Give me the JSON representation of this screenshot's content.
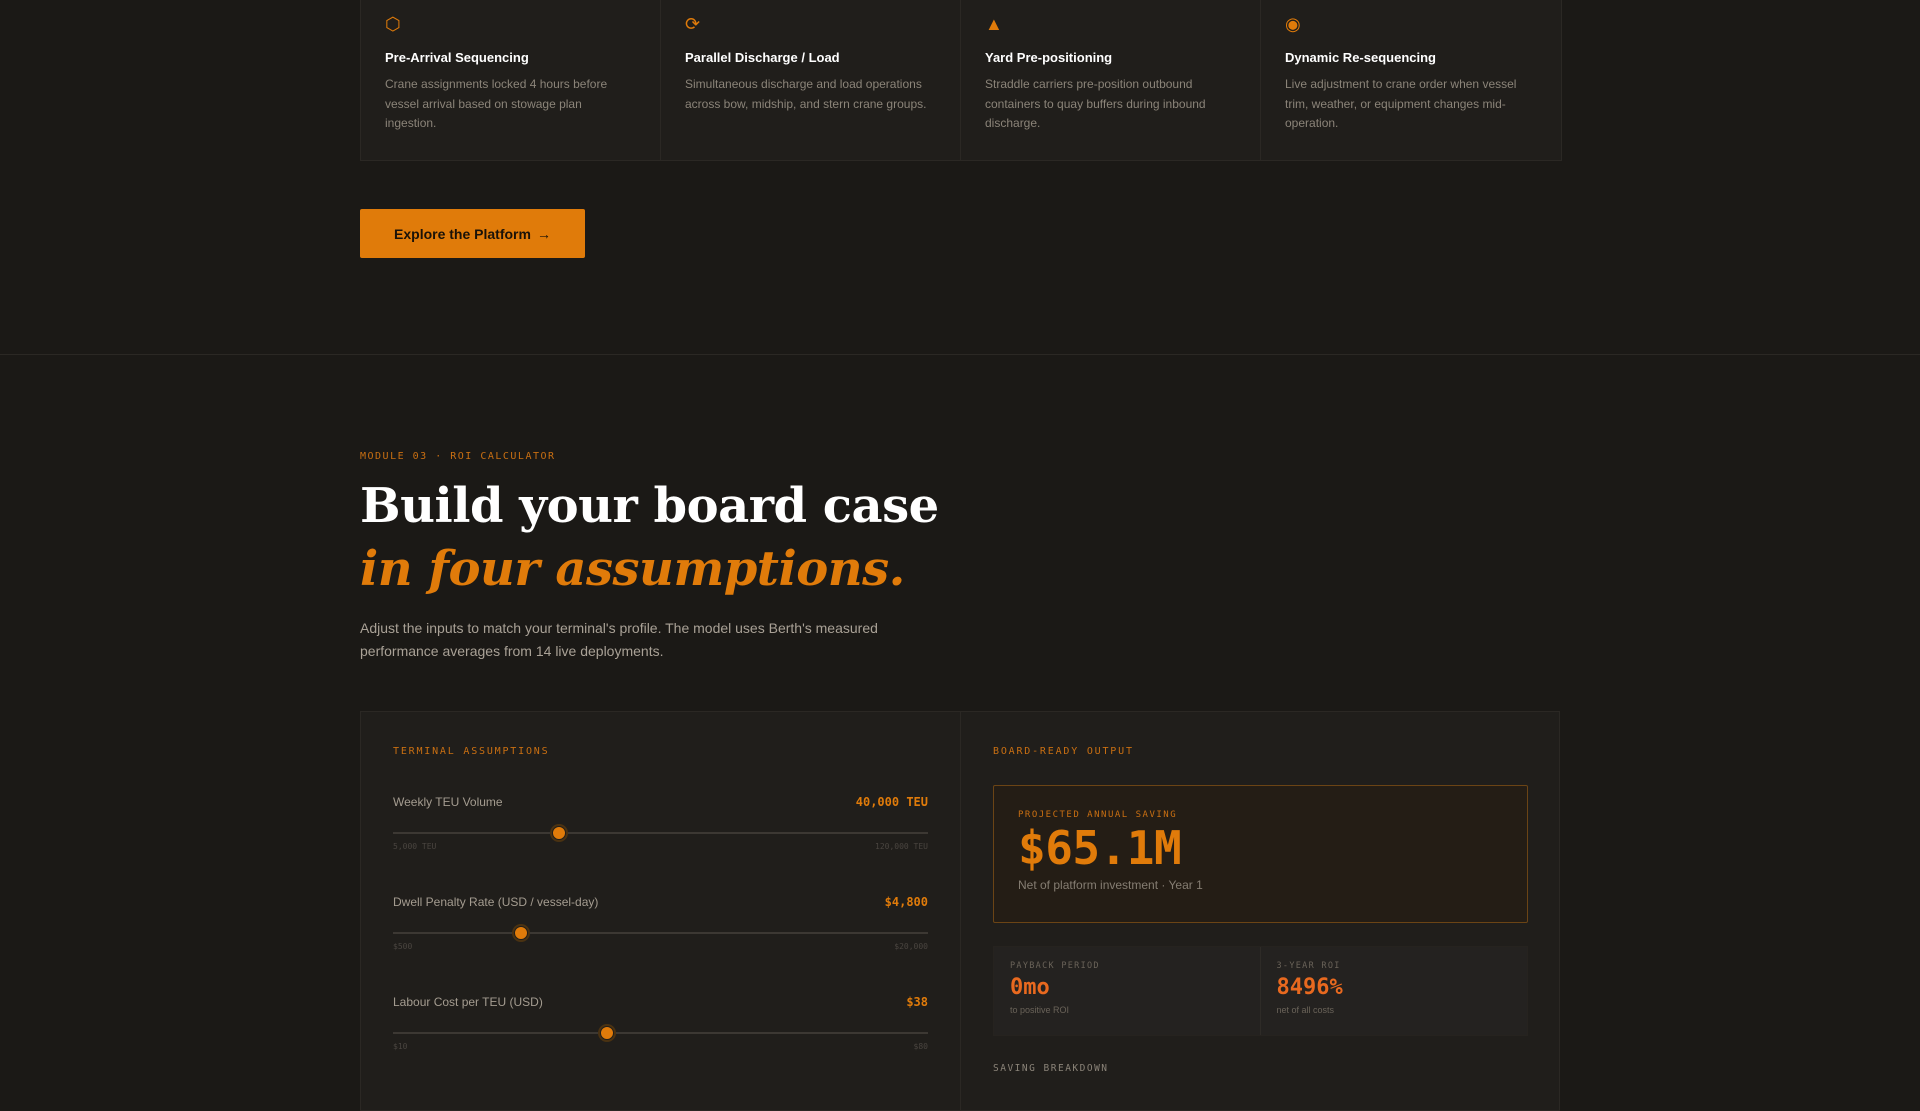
{
  "features": [
    {
      "icon": "⬡",
      "icon_name": "hexagon-icon",
      "title": "Pre-Arrival Sequencing",
      "desc": "Crane assignments locked 4 hours before vessel arrival based on stowage plan ingestion."
    },
    {
      "icon": "⟳",
      "icon_name": "cycle-icon",
      "title": "Parallel Discharge / Load",
      "desc": "Simultaneous discharge and load operations across bow, midship, and stern crane groups."
    },
    {
      "icon": "▲",
      "icon_name": "triangle-icon",
      "title": "Yard Pre-positioning",
      "desc": "Straddle carriers pre-position outbound containers to quay buffers during inbound discharge."
    },
    {
      "icon": "◉",
      "icon_name": "target-icon",
      "title": "Dynamic Re-sequencing",
      "desc": "Live adjustment to crane order when vessel trim, weather, or equipment changes mid-operation."
    }
  ],
  "cta": {
    "label": "Explore the Platform",
    "arrow": "→"
  },
  "roi": {
    "eyebrow": "MODULE 03 · ROI CALCULATOR",
    "heading": "Build your board case",
    "heading_accent": "in four assumptions.",
    "intro": "Adjust the inputs to match your terminal's profile. The model uses Berth's measured performance averages from 14 live deployments."
  },
  "assumptions": {
    "label": "TERMINAL ASSUMPTIONS",
    "sliders": [
      {
        "label": "Weekly TEU Volume",
        "value": "40,000 TEU",
        "min": "5,000 TEU",
        "max": "120,000 TEU",
        "fraction": 0.31
      },
      {
        "label": "Dwell Penalty Rate (USD / vessel-day)",
        "value": "$4,800",
        "min": "$500",
        "max": "$20,000",
        "fraction": 0.24
      },
      {
        "label": "Labour Cost per TEU (USD)",
        "value": "$38",
        "min": "$10",
        "max": "$80",
        "fraction": 0.4
      }
    ]
  },
  "output": {
    "label": "BOARD-READY OUTPUT",
    "saving_label": "PROJECTED ANNUAL SAVING",
    "saving_value": "$65.1M",
    "saving_sub": "Net of platform investment · Year 1",
    "metrics": [
      {
        "label": "PAYBACK PERIOD",
        "value": "0mo",
        "sub": "to positive ROI"
      },
      {
        "label": "3-YEAR ROI",
        "value": "8496%",
        "sub": "net of all costs"
      }
    ],
    "breakdown_label": "SAVING BREAKDOWN"
  },
  "colors": {
    "accent": "#e07b0a",
    "background": "#1b1916",
    "panel": "#201e1b",
    "metric": "#e8691f"
  }
}
